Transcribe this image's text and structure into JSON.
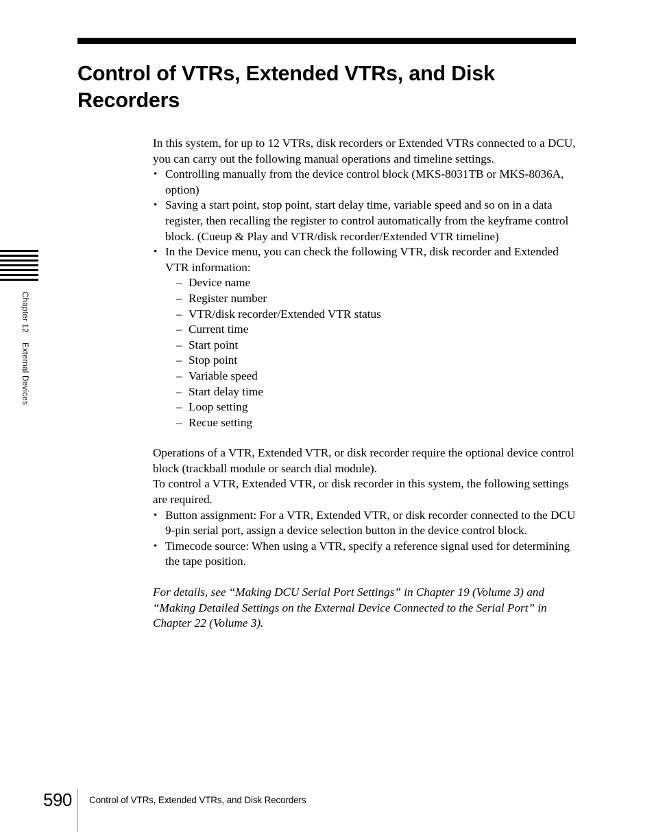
{
  "margin": {
    "chapter_label": "Chapter 12",
    "chapter_section": "External Devices",
    "tab_mark_count": 7
  },
  "header": {
    "title": "Control of VTRs, Extended VTRs, and Disk Recorders"
  },
  "body": {
    "intro_paragraph": "In this system, for up to 12 VTRs, disk recorders or Extended VTRs connected to a DCU, you can carry out the following manual operations and timeline settings.",
    "intro_bullets": [
      "Controlling manually from the device control block (MKS-8031TB or MKS-8036A, option)",
      "Saving a start point, stop point, start delay time, variable speed and so on in a data register, then recalling the register to control automatically from the keyframe control block. (Cueup & Play and VTR/disk recorder/Extended VTR timeline)",
      "In the Device menu, you can check the following VTR, disk recorder and Extended VTR information:"
    ],
    "device_info_items": [
      "Device name",
      "Register number",
      "VTR/disk recorder/Extended VTR status",
      "Current time",
      "Start point",
      "Stop point",
      "Variable speed",
      "Start delay time",
      "Loop setting",
      "Recue setting"
    ],
    "requirements_paragraph_1": "Operations of a VTR, Extended VTR, or disk recorder require the optional device control block (trackball module or search dial module).",
    "requirements_paragraph_2": "To control a VTR, Extended VTR, or disk recorder in this system, the following settings are required.",
    "requirements_bullets": [
      "Button assignment: For a VTR, Extended VTR, or disk recorder connected to the DCU 9-pin serial port, assign a device selection button in the device control block.",
      "Timecode source: When using a VTR, specify a reference signal used for determining the tape position."
    ],
    "cross_reference_note": "For details, see “Making DCU Serial Port Settings” in Chapter 19 (Volume 3) and “Making Detailed Settings on the External Device Connected to the Serial Port” in Chapter 22 (Volume 3)."
  },
  "footer": {
    "page_number": "590",
    "running_title": "Control of VTRs, Extended VTRs, and Disk Recorders"
  },
  "colors": {
    "text": "#000000",
    "rule": "#000000",
    "footer_rule": "#8a8a8a",
    "background": "#ffffff"
  }
}
